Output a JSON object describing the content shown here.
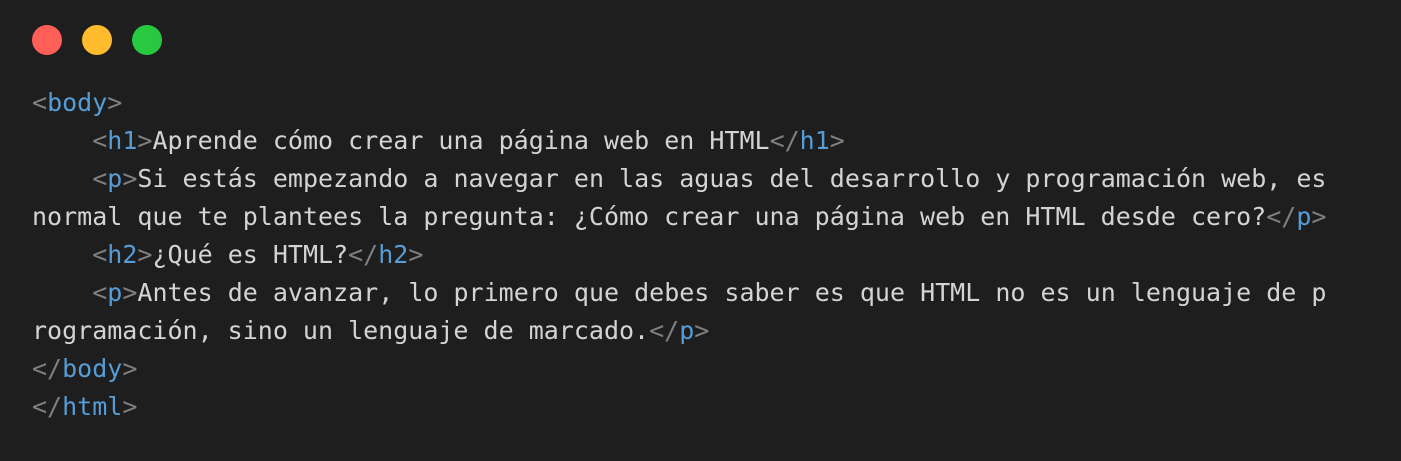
{
  "window": {
    "controls": [
      {
        "name": "close",
        "color": "#ff5f57"
      },
      {
        "name": "minimize",
        "color": "#febc2e"
      },
      {
        "name": "maximize",
        "color": "#28c840"
      }
    ]
  },
  "colors": {
    "background": "#1e1e1e",
    "text": "#d4d4d4",
    "punctuation": "#808080",
    "tag": "#569cd6"
  },
  "code": {
    "lines": [
      [
        {
          "k": "p",
          "v": "<"
        },
        {
          "k": "t",
          "v": "body"
        },
        {
          "k": "p",
          "v": ">"
        }
      ],
      [
        {
          "k": "x",
          "v": "    "
        },
        {
          "k": "p",
          "v": "<"
        },
        {
          "k": "t",
          "v": "h1"
        },
        {
          "k": "p",
          "v": ">"
        },
        {
          "k": "x",
          "v": "Aprende cómo crear una página web en HTML"
        },
        {
          "k": "p",
          "v": "</"
        },
        {
          "k": "t",
          "v": "h1"
        },
        {
          "k": "p",
          "v": ">"
        }
      ],
      [
        {
          "k": "x",
          "v": "    "
        },
        {
          "k": "p",
          "v": "<"
        },
        {
          "k": "t",
          "v": "p"
        },
        {
          "k": "p",
          "v": ">"
        },
        {
          "k": "x",
          "v": "Si estás empezando a navegar en las aguas del desarrollo y programación web, es"
        }
      ],
      [
        {
          "k": "x",
          "v": "normal que te plantees la pregunta: ¿Cómo crear una página web en HTML desde cero?"
        },
        {
          "k": "p",
          "v": "</"
        },
        {
          "k": "t",
          "v": "p"
        },
        {
          "k": "p",
          "v": ">"
        }
      ],
      [
        {
          "k": "x",
          "v": "    "
        },
        {
          "k": "p",
          "v": "<"
        },
        {
          "k": "t",
          "v": "h2"
        },
        {
          "k": "p",
          "v": ">"
        },
        {
          "k": "x",
          "v": "¿Qué es HTML?"
        },
        {
          "k": "p",
          "v": "</"
        },
        {
          "k": "t",
          "v": "h2"
        },
        {
          "k": "p",
          "v": ">"
        }
      ],
      [
        {
          "k": "x",
          "v": "    "
        },
        {
          "k": "p",
          "v": "<"
        },
        {
          "k": "t",
          "v": "p"
        },
        {
          "k": "p",
          "v": ">"
        },
        {
          "k": "x",
          "v": "Antes de avanzar, lo primero que debes saber es que HTML no es un lenguaje de p"
        }
      ],
      [
        {
          "k": "x",
          "v": "rogramación, sino un lenguaje de marcado."
        },
        {
          "k": "p",
          "v": "</"
        },
        {
          "k": "t",
          "v": "p"
        },
        {
          "k": "p",
          "v": ">"
        }
      ],
      [
        {
          "k": "p",
          "v": "</"
        },
        {
          "k": "t",
          "v": "body"
        },
        {
          "k": "p",
          "v": ">"
        }
      ],
      [
        {
          "k": "p",
          "v": "</"
        },
        {
          "k": "t",
          "v": "html"
        },
        {
          "k": "p",
          "v": ">"
        }
      ]
    ]
  }
}
